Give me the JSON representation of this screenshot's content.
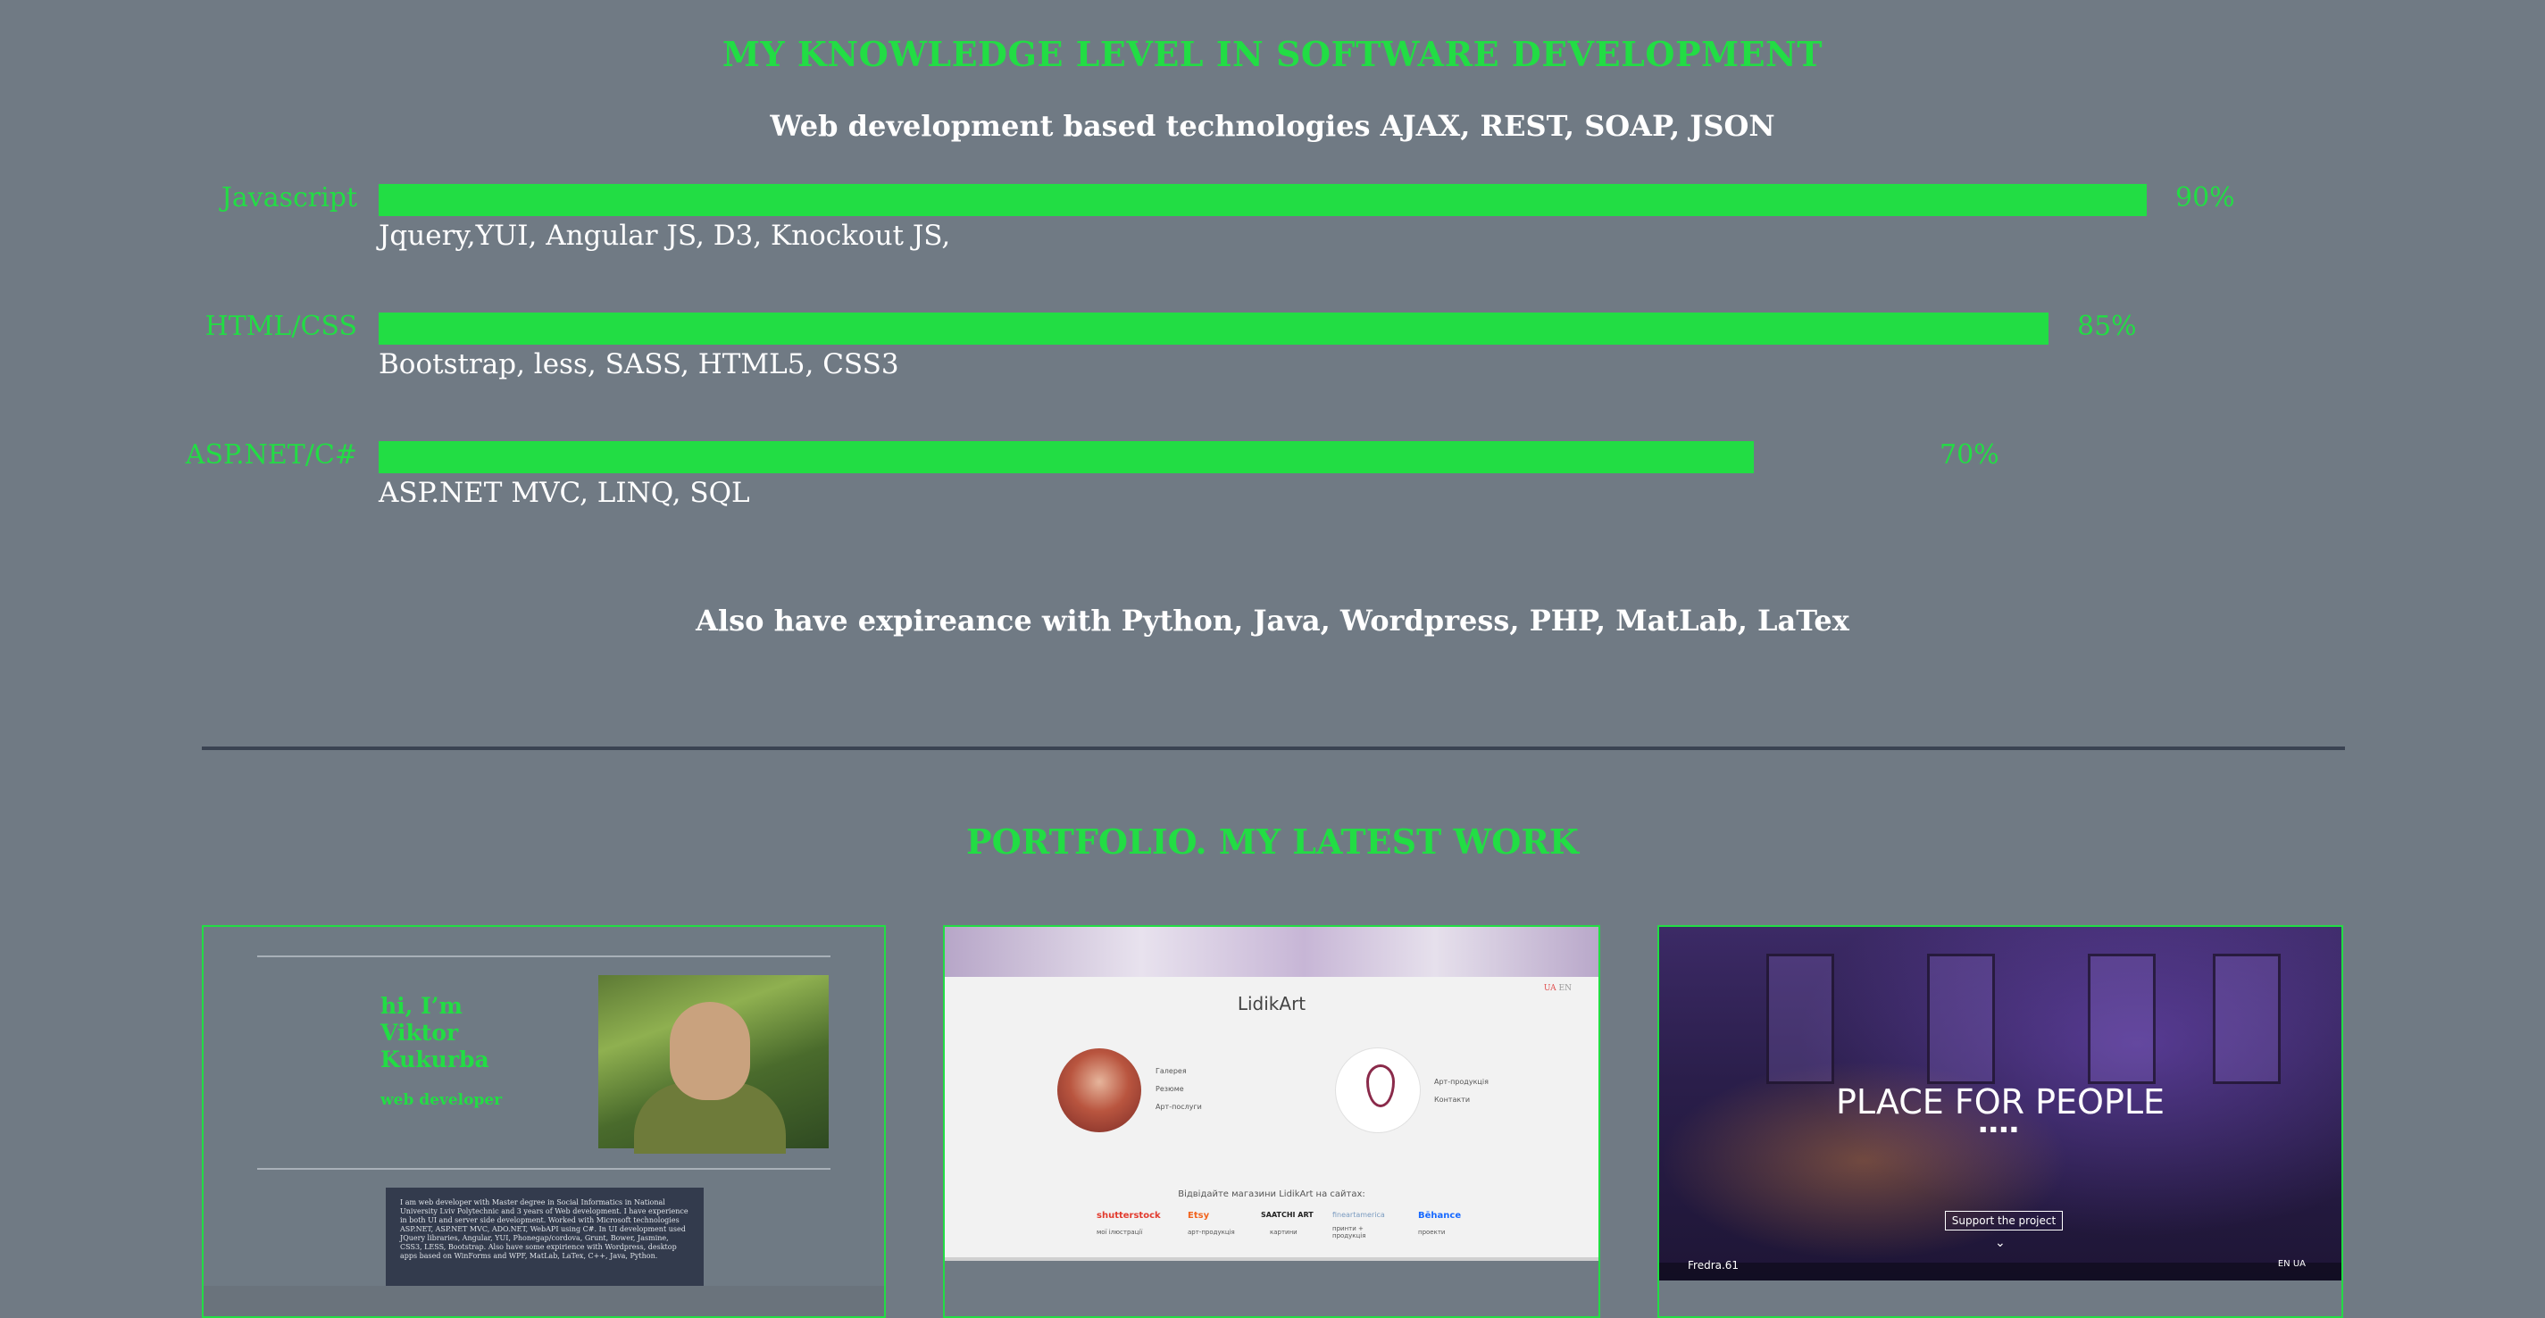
{
  "knowledge": {
    "title": "MY KNOWLEDGE LEVEL IN SOFTWARE DEVELOPMENT",
    "subtitle": "Web development based technologies AJAX, REST, SOAP, JSON",
    "skills": [
      {
        "name": "Javascript",
        "percent": 90,
        "percent_label": "90%",
        "details": "Jquery,YUI, Angular JS, D3, Knockout JS,"
      },
      {
        "name": "HTML/CSS",
        "percent": 85,
        "percent_label": "85%",
        "details": "Bootstrap, less, SASS, HTML5, CSS3"
      },
      {
        "name": "ASP.NET/C#",
        "percent": 70,
        "percent_label": "70%",
        "details": "ASP.NET MVC, LINQ, SQL"
      }
    ],
    "also": "Also have expireance with Python, Java, Wordpress, PHP, MatLab, LaTex"
  },
  "colors": {
    "accent": "#22dd44",
    "background": "#707a84",
    "divider": "#3a4352"
  },
  "portfolio": {
    "title": "PORTFOLIO. MY LATEST WORK",
    "cards": [
      {
        "hello": "hi, I’m Viktor Kukurba",
        "role": "web developer",
        "about": "I am web developer with Master degree in Social Informatics in National University Lviv Polytechnic and 3 years of Web development. I have experience in both UI and server side development. Worked with Microsoft technologies ASP.NET, ASP.NET MVC, ADO.NET, WebAPI using C#. In UI development used JQuery libraries, Angular, YUI, Phonegap/cordova, Grunt, Bower, Jasmine, CSS3, LESS, Bootstrap. Also have some expirience with Wordpress, desktop apps based on WinForms and WPF, MatLab, LaTex, C++, Java, Python."
      },
      {
        "brand": "LidikArt",
        "lang_active": "UA",
        "lang_other": "EN",
        "menu_left": [
          "Галерея",
          "Резюме",
          "Арт-послуги"
        ],
        "menu_right": [
          "Арт-продукція",
          "Контакти"
        ],
        "shops_title": "Відвідайте магазини LidikArt на сайтах:",
        "shops": [
          {
            "name": "shutterstock",
            "sub": "мої ілюстрації",
            "color": "#e23b2e"
          },
          {
            "name": "Etsy",
            "sub": "арт-продукція",
            "color": "#f1641e"
          },
          {
            "name": "SAATCHI ART",
            "sub": "картини",
            "color": "#222222"
          },
          {
            "name": "fineartamerica",
            "sub": "принти + продукція",
            "color": "#7a9bc0"
          },
          {
            "name": "Bēhance",
            "sub": "проекти",
            "color": "#1769ff"
          }
        ]
      },
      {
        "headline": "PLACE FOR PEOPLE",
        "cta": "Support the project",
        "brand": "Fredra.61",
        "langs": "EN  UA"
      }
    ]
  }
}
